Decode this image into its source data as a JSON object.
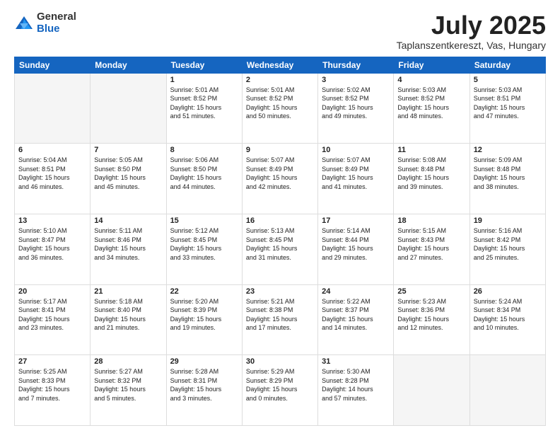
{
  "header": {
    "logo": {
      "general": "General",
      "blue": "Blue"
    },
    "month": "July 2025",
    "location": "Taplanszentkereszt, Vas, Hungary"
  },
  "weekdays": [
    "Sunday",
    "Monday",
    "Tuesday",
    "Wednesday",
    "Thursday",
    "Friday",
    "Saturday"
  ],
  "weeks": [
    [
      {
        "day": "",
        "info": ""
      },
      {
        "day": "",
        "info": ""
      },
      {
        "day": "1",
        "info": "Sunrise: 5:01 AM\nSunset: 8:52 PM\nDaylight: 15 hours\nand 51 minutes."
      },
      {
        "day": "2",
        "info": "Sunrise: 5:01 AM\nSunset: 8:52 PM\nDaylight: 15 hours\nand 50 minutes."
      },
      {
        "day": "3",
        "info": "Sunrise: 5:02 AM\nSunset: 8:52 PM\nDaylight: 15 hours\nand 49 minutes."
      },
      {
        "day": "4",
        "info": "Sunrise: 5:03 AM\nSunset: 8:52 PM\nDaylight: 15 hours\nand 48 minutes."
      },
      {
        "day": "5",
        "info": "Sunrise: 5:03 AM\nSunset: 8:51 PM\nDaylight: 15 hours\nand 47 minutes."
      }
    ],
    [
      {
        "day": "6",
        "info": "Sunrise: 5:04 AM\nSunset: 8:51 PM\nDaylight: 15 hours\nand 46 minutes."
      },
      {
        "day": "7",
        "info": "Sunrise: 5:05 AM\nSunset: 8:50 PM\nDaylight: 15 hours\nand 45 minutes."
      },
      {
        "day": "8",
        "info": "Sunrise: 5:06 AM\nSunset: 8:50 PM\nDaylight: 15 hours\nand 44 minutes."
      },
      {
        "day": "9",
        "info": "Sunrise: 5:07 AM\nSunset: 8:49 PM\nDaylight: 15 hours\nand 42 minutes."
      },
      {
        "day": "10",
        "info": "Sunrise: 5:07 AM\nSunset: 8:49 PM\nDaylight: 15 hours\nand 41 minutes."
      },
      {
        "day": "11",
        "info": "Sunrise: 5:08 AM\nSunset: 8:48 PM\nDaylight: 15 hours\nand 39 minutes."
      },
      {
        "day": "12",
        "info": "Sunrise: 5:09 AM\nSunset: 8:48 PM\nDaylight: 15 hours\nand 38 minutes."
      }
    ],
    [
      {
        "day": "13",
        "info": "Sunrise: 5:10 AM\nSunset: 8:47 PM\nDaylight: 15 hours\nand 36 minutes."
      },
      {
        "day": "14",
        "info": "Sunrise: 5:11 AM\nSunset: 8:46 PM\nDaylight: 15 hours\nand 34 minutes."
      },
      {
        "day": "15",
        "info": "Sunrise: 5:12 AM\nSunset: 8:45 PM\nDaylight: 15 hours\nand 33 minutes."
      },
      {
        "day": "16",
        "info": "Sunrise: 5:13 AM\nSunset: 8:45 PM\nDaylight: 15 hours\nand 31 minutes."
      },
      {
        "day": "17",
        "info": "Sunrise: 5:14 AM\nSunset: 8:44 PM\nDaylight: 15 hours\nand 29 minutes."
      },
      {
        "day": "18",
        "info": "Sunrise: 5:15 AM\nSunset: 8:43 PM\nDaylight: 15 hours\nand 27 minutes."
      },
      {
        "day": "19",
        "info": "Sunrise: 5:16 AM\nSunset: 8:42 PM\nDaylight: 15 hours\nand 25 minutes."
      }
    ],
    [
      {
        "day": "20",
        "info": "Sunrise: 5:17 AM\nSunset: 8:41 PM\nDaylight: 15 hours\nand 23 minutes."
      },
      {
        "day": "21",
        "info": "Sunrise: 5:18 AM\nSunset: 8:40 PM\nDaylight: 15 hours\nand 21 minutes."
      },
      {
        "day": "22",
        "info": "Sunrise: 5:20 AM\nSunset: 8:39 PM\nDaylight: 15 hours\nand 19 minutes."
      },
      {
        "day": "23",
        "info": "Sunrise: 5:21 AM\nSunset: 8:38 PM\nDaylight: 15 hours\nand 17 minutes."
      },
      {
        "day": "24",
        "info": "Sunrise: 5:22 AM\nSunset: 8:37 PM\nDaylight: 15 hours\nand 14 minutes."
      },
      {
        "day": "25",
        "info": "Sunrise: 5:23 AM\nSunset: 8:36 PM\nDaylight: 15 hours\nand 12 minutes."
      },
      {
        "day": "26",
        "info": "Sunrise: 5:24 AM\nSunset: 8:34 PM\nDaylight: 15 hours\nand 10 minutes."
      }
    ],
    [
      {
        "day": "27",
        "info": "Sunrise: 5:25 AM\nSunset: 8:33 PM\nDaylight: 15 hours\nand 7 minutes."
      },
      {
        "day": "28",
        "info": "Sunrise: 5:27 AM\nSunset: 8:32 PM\nDaylight: 15 hours\nand 5 minutes."
      },
      {
        "day": "29",
        "info": "Sunrise: 5:28 AM\nSunset: 8:31 PM\nDaylight: 15 hours\nand 3 minutes."
      },
      {
        "day": "30",
        "info": "Sunrise: 5:29 AM\nSunset: 8:29 PM\nDaylight: 15 hours\nand 0 minutes."
      },
      {
        "day": "31",
        "info": "Sunrise: 5:30 AM\nSunset: 8:28 PM\nDaylight: 14 hours\nand 57 minutes."
      },
      {
        "day": "",
        "info": ""
      },
      {
        "day": "",
        "info": ""
      }
    ]
  ]
}
